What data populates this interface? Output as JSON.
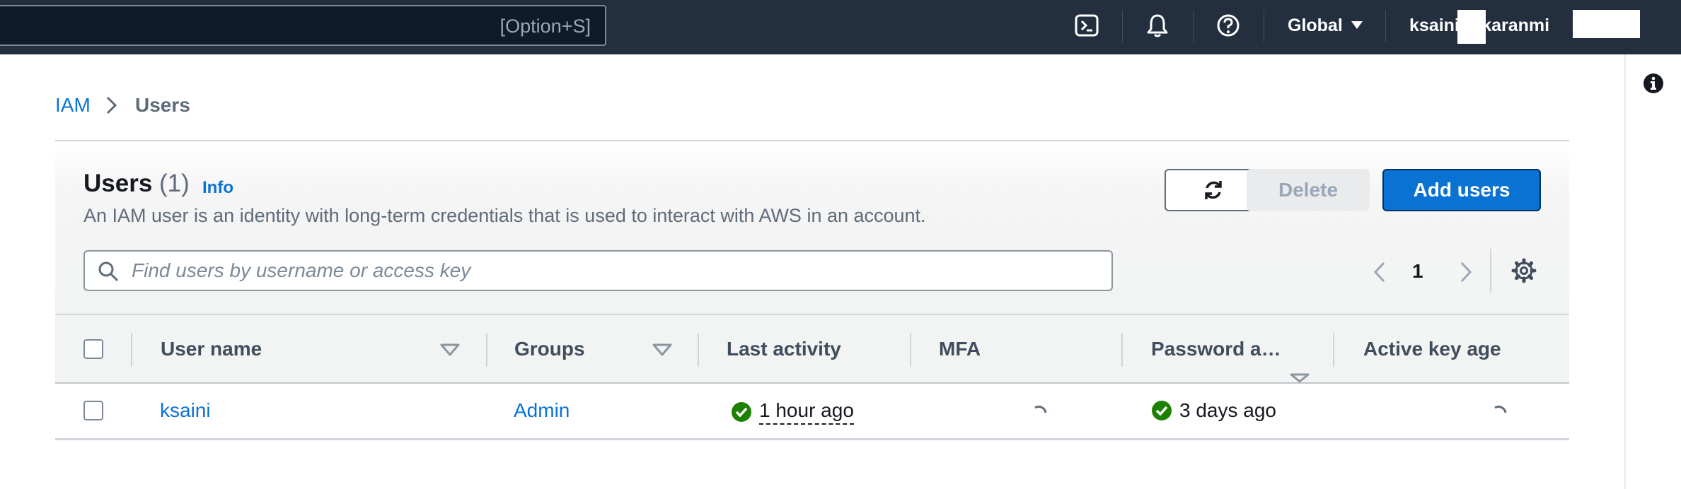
{
  "topnav": {
    "search_shortcut": "[Option+S]",
    "region": "Global",
    "account": "ksaini@ karanmi"
  },
  "icons": {
    "cloudshell": "cloudshell-icon",
    "notifications": "bell-icon",
    "help": "help-icon",
    "info": "info-icon",
    "settings": "gear-icon"
  },
  "breadcrumb": {
    "items": [
      "IAM",
      "Users"
    ]
  },
  "users_panel": {
    "title": "Users",
    "count": "(1)",
    "info_label": "Info",
    "description": "An IAM user is an identity with long-term credentials that is used to interact with AWS in an account.",
    "delete_label": "Delete",
    "add_label": "Add users",
    "search_placeholder": "Find users by username or access key",
    "page": "1"
  },
  "table": {
    "columns": [
      "User name",
      "Groups",
      "Last activity",
      "MFA",
      "Password a…",
      "Active key age"
    ],
    "rows": [
      {
        "user_name": "ksaini",
        "groups": "Admin",
        "last_activity": "1 hour ago",
        "mfa": "",
        "password_age": "3 days ago",
        "active_key_age": ""
      }
    ]
  },
  "colors": {
    "nav_bg": "#232f3e",
    "link": "#0972d3",
    "primary_button": "#0972d3",
    "success": "#037f0c"
  }
}
